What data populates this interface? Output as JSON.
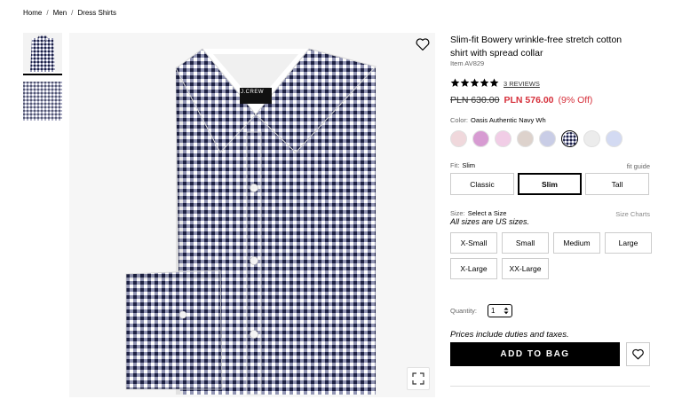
{
  "breadcrumb": {
    "items": [
      "Home",
      "Men",
      "Dress Shirts"
    ],
    "separator": "/"
  },
  "gallery": {
    "thumbnail_count": 2,
    "main_image": "gingham-shirt-folded",
    "brand_label": "J.CREW",
    "icons": [
      "heart-icon",
      "expand-icon"
    ]
  },
  "product": {
    "title": "Slim-fit Bowery wrinkle-free stretch cotton shirt with spread collar",
    "item_number": "Item AV829",
    "rating_stars": 5,
    "reviews_label": "3 REVIEWS",
    "price_original": "PLN 630.00",
    "price_sale": "PLN 576.00",
    "discount": "(9% Off)"
  },
  "color": {
    "label": "Color:",
    "selected": "Oasis Authentic Navy Wh",
    "swatches": [
      "#f0d8dc",
      "#d79bd2",
      "#f1cde6",
      "#ddd2cc",
      "#c9cde6",
      "gingham-navy",
      "#ececec",
      "#d3daf2"
    ],
    "selected_index": 5
  },
  "fit": {
    "label": "Fit:",
    "selected": "Slim",
    "guide_label": "fit guide",
    "options": [
      "Classic",
      "Slim",
      "Tall"
    ],
    "selected_index": 1
  },
  "size": {
    "label": "Size:",
    "selected": "Select a Size",
    "charts_label": "Size Charts",
    "note": "All sizes are US sizes.",
    "options": [
      "X-Small",
      "Small",
      "Medium",
      "Large",
      "X-Large",
      "XX-Large"
    ]
  },
  "quantity": {
    "label": "Quantity:",
    "value": "1"
  },
  "purchase": {
    "duties_note": "Prices include duties and taxes.",
    "add_to_bag_label": "ADD TO BAG"
  },
  "colors": {
    "sale_red": "#d6303b",
    "primary_black": "#000000",
    "navy_check": "#2b2f55"
  }
}
